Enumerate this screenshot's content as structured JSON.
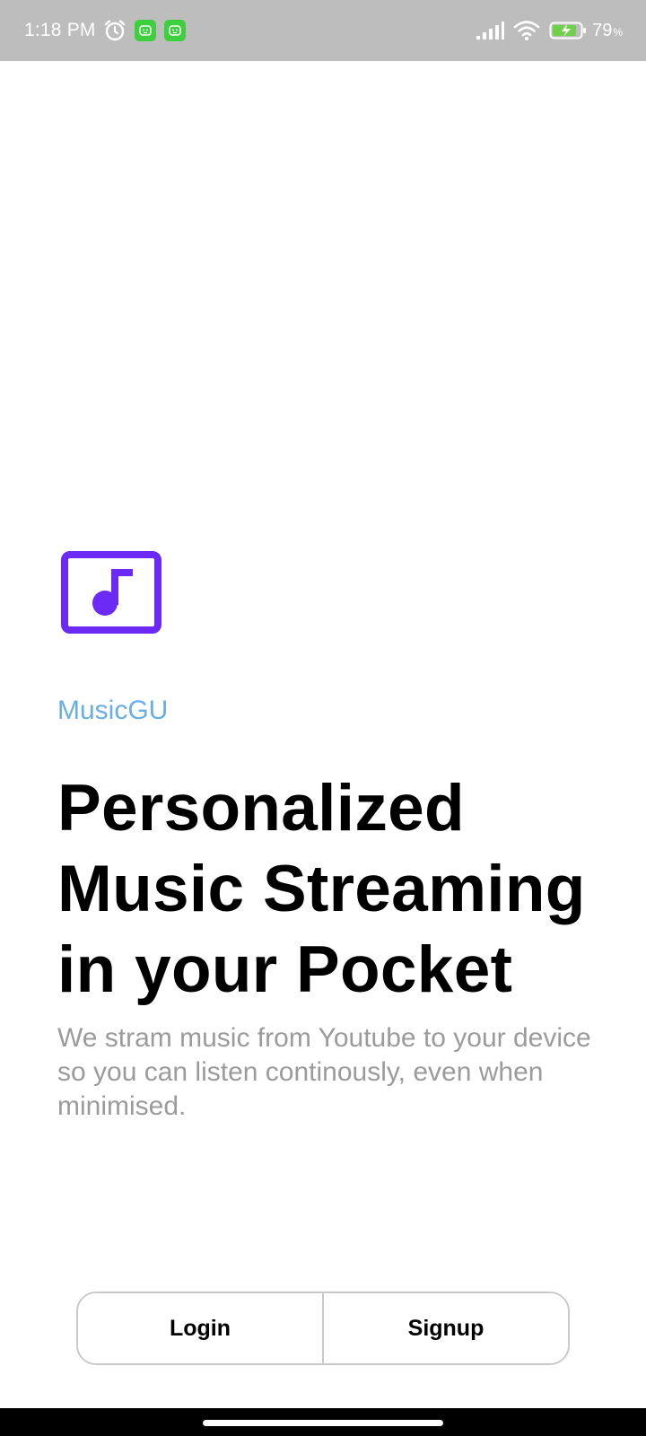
{
  "status_bar": {
    "time": "1:18 PM",
    "icons_left": [
      "alarm-icon",
      "app-notification-icon",
      "app-notification-icon"
    ],
    "icons_right": [
      "signal-icon",
      "wifi-icon",
      "battery-charging-icon"
    ],
    "battery_percent": "79",
    "battery_unit": "%",
    "background_color": "#bdbdbd"
  },
  "app": {
    "logo_icon": "music-note-icon",
    "brand_name": "MusicGU",
    "brand_color": "#6aaee6",
    "accent_color": "#6c2bf5",
    "headline": "Personalized Music Streaming in your Pocket",
    "description": "We stram music from Youtube to your device so you can listen continously, even when minimised."
  },
  "actions": {
    "login_label": "Login",
    "signup_label": "Signup"
  }
}
